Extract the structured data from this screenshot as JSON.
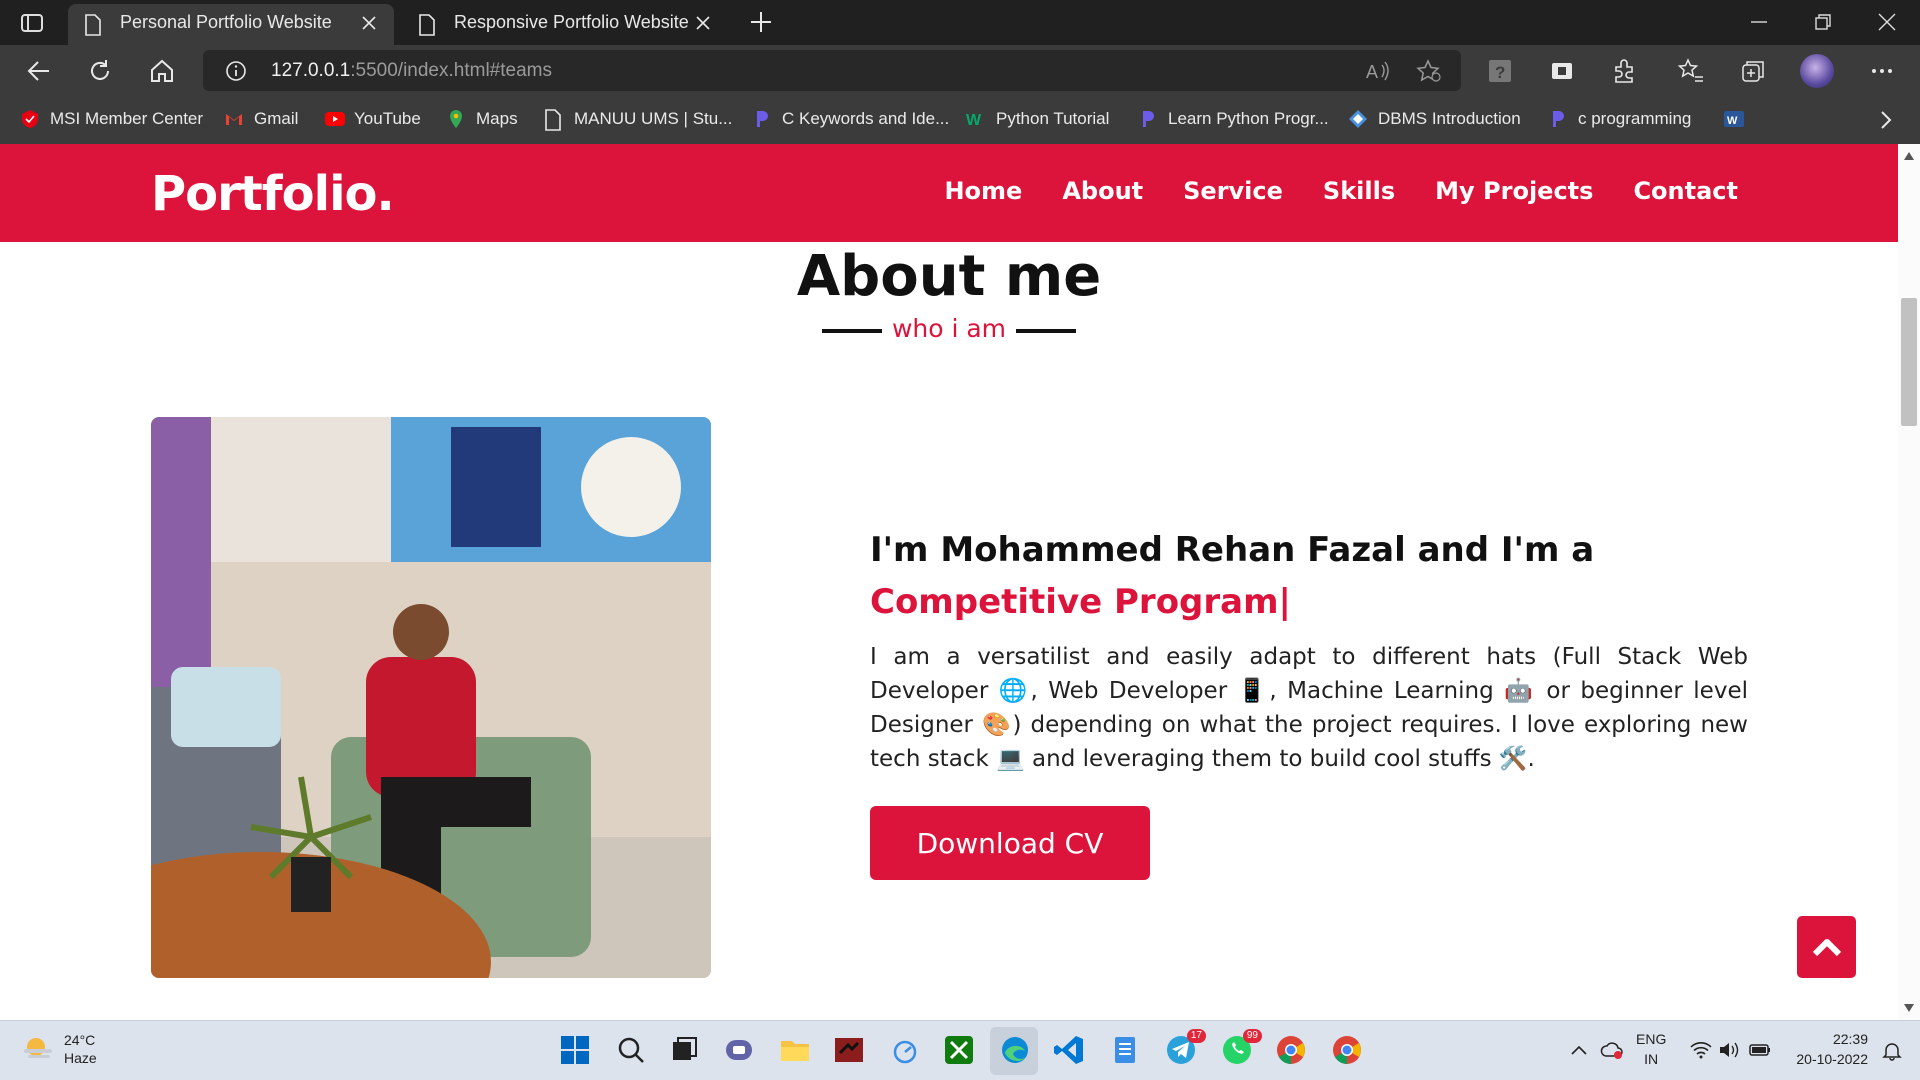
{
  "browser": {
    "tabs": [
      {
        "title": "Personal Portfolio Website",
        "active": true
      },
      {
        "title": "Responsive Portfolio Website",
        "active": false
      }
    ],
    "url_host": "127.0.0.1",
    "url_path": ":5500/index.html#teams",
    "bookmarks": [
      {
        "label": "MSI Member Center",
        "icon": "msi-icon",
        "color": "#e60012"
      },
      {
        "label": "Gmail",
        "icon": "gmail-icon",
        "color": "#ea4335"
      },
      {
        "label": "YouTube",
        "icon": "youtube-icon",
        "color": "#ff0000"
      },
      {
        "label": "Maps",
        "icon": "maps-icon",
        "color": "#34a853"
      },
      {
        "label": "MANUU UMS | Stu...",
        "icon": "page-icon",
        "color": "#dddddd"
      },
      {
        "label": "C Keywords and Ide...",
        "icon": "programiz-icon",
        "color": "#6c5ce7"
      },
      {
        "label": "Python Tutorial",
        "icon": "w3-icon",
        "color": "#04aa6d"
      },
      {
        "label": "Learn Python Progr...",
        "icon": "programiz-icon",
        "color": "#6c5ce7"
      },
      {
        "label": "DBMS Introduction",
        "icon": "diamond-icon",
        "color": "#4a90e2"
      },
      {
        "label": "c programming",
        "icon": "programiz-icon",
        "color": "#6c5ce7"
      }
    ]
  },
  "page": {
    "brand": "Portfolio.",
    "nav": [
      "Home",
      "About",
      "Service",
      "Skills",
      "My Projects",
      "Contact"
    ],
    "section_title": "About me",
    "section_subtitle": "who i am",
    "intro": "I'm Mohammed Rehan Fazal and I'm a",
    "typed_text": "Competitive Program|",
    "description": "I am a versatilist and easily adapt to different hats (Full Stack Web Developer 🌐, Web Developer 📱, Machine Learning 🤖 or beginner level Designer 🎨) depending on what the project requires. I love exploring new tech stack 💻 and leveraging them to build cool stuffs 🛠️.",
    "cv_button": "Download CV",
    "accent": "#dc143c"
  },
  "taskbar": {
    "weather_temp": "24°C",
    "weather_desc": "Haze",
    "lang_1": "ENG",
    "lang_2": "IN",
    "time": "22:39",
    "date": "20-10-2022",
    "badges": {
      "telegram": "17",
      "whatsapp": "99"
    }
  }
}
